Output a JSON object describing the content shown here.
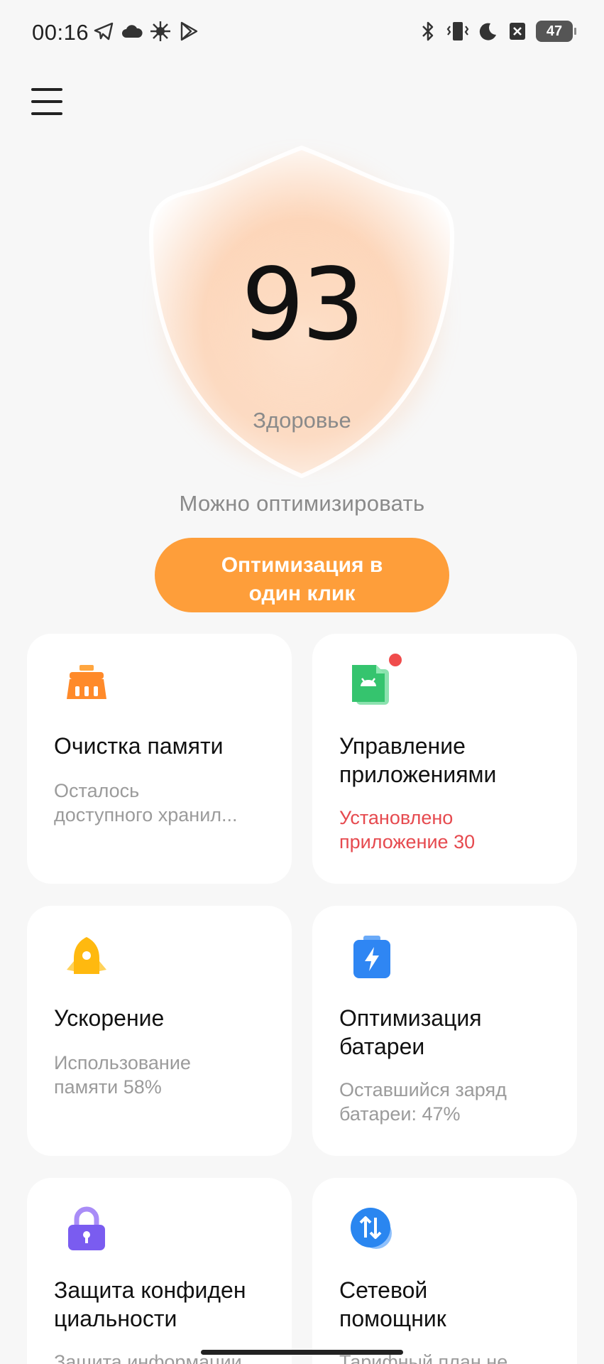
{
  "status_bar": {
    "time": "00:16",
    "battery": "47",
    "left_icons": [
      "telegram-icon",
      "cloud-icon",
      "sun-icon",
      "play-store-icon"
    ],
    "right_icons": [
      "bluetooth-icon",
      "vibrate-icon",
      "moon-icon",
      "no-sim-icon",
      "battery-icon"
    ]
  },
  "health": {
    "score": "93",
    "label": "Здоровье",
    "status": "Можно оптимизировать"
  },
  "optimize_button": {
    "line1": "Оптимизация в",
    "line2": "один клик"
  },
  "cards": [
    {
      "title": "Очистка памяти",
      "subtitle": "Осталось доступного хранил...",
      "subtitle_line1": "Осталось",
      "subtitle_line2": "доступного хранил...",
      "icon": "broom-icon"
    },
    {
      "title_line1": "Управление",
      "title_line2": "приложениями",
      "subtitle_line1": "Установлено",
      "subtitle_line2": "приложение 30",
      "icon": "app-manager-icon",
      "badge": true
    },
    {
      "title": "Ускорение",
      "subtitle_line1": "Использование",
      "subtitle_line2": "памяти 58%",
      "icon": "rocket-icon"
    },
    {
      "title_line1": "Оптимизация",
      "title_line2": "батареи",
      "subtitle_line1": "Оставшийся заряд",
      "subtitle_line2": "батареи: 47%",
      "icon": "battery-bolt-icon"
    },
    {
      "title_line1": "Защита конфиден",
      "title_line2": "циальности",
      "subtitle_line1": "Защита информации",
      "icon": "lock-icon"
    },
    {
      "title_line1": "Сетевой",
      "title_line2": "помощник",
      "subtitle_line1": "Тарифный план не",
      "icon": "network-arrows-icon"
    }
  ],
  "colors": {
    "accent": "#fe9e3a",
    "alert": "#e64a4f",
    "background": "#f7f7f7"
  }
}
